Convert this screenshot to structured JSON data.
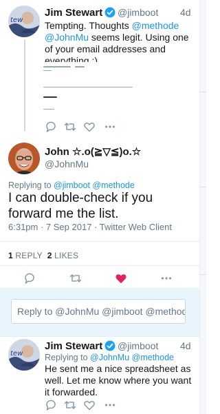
{
  "tweet1": {
    "name": "Jim Stewart",
    "handle": "@jimboot",
    "time": "4d",
    "text_part1": "Tempting. Thoughts ",
    "mention1": "@methode",
    "mention2": "@JohnMu",
    "text_part2": " seems legit. Using one of your email addresses and everything :)"
  },
  "main_tweet": {
    "name": "John ☆.o(≧▽≦)o.☆",
    "handle": "@JohnMu",
    "replying_prefix": "Replying to ",
    "replying_mentions": "@jimboot @methode",
    "text": "I can double-check if you forward me the list.",
    "meta": "6:31pm · 7 Sep 2017 · Twitter Web Client",
    "reply_count": "1",
    "reply_label": "REPLY",
    "like_count": "2",
    "like_label": "LIKES"
  },
  "reply_box": {
    "placeholder": "Reply to @JohnMu @jimboot @methode"
  },
  "tweet3": {
    "name": "Jim Stewart",
    "handle": "@jimboot",
    "time": "4d",
    "replying_prefix": "Replying to ",
    "replying_mentions": "@JohnMu @methode",
    "text": "He sent me a nice spreadsheet as well. Let me know where you want it forwarded."
  },
  "colors": {
    "link": "#1b95e0",
    "like_active": "#e0245e",
    "verified": "#1da1f2"
  }
}
